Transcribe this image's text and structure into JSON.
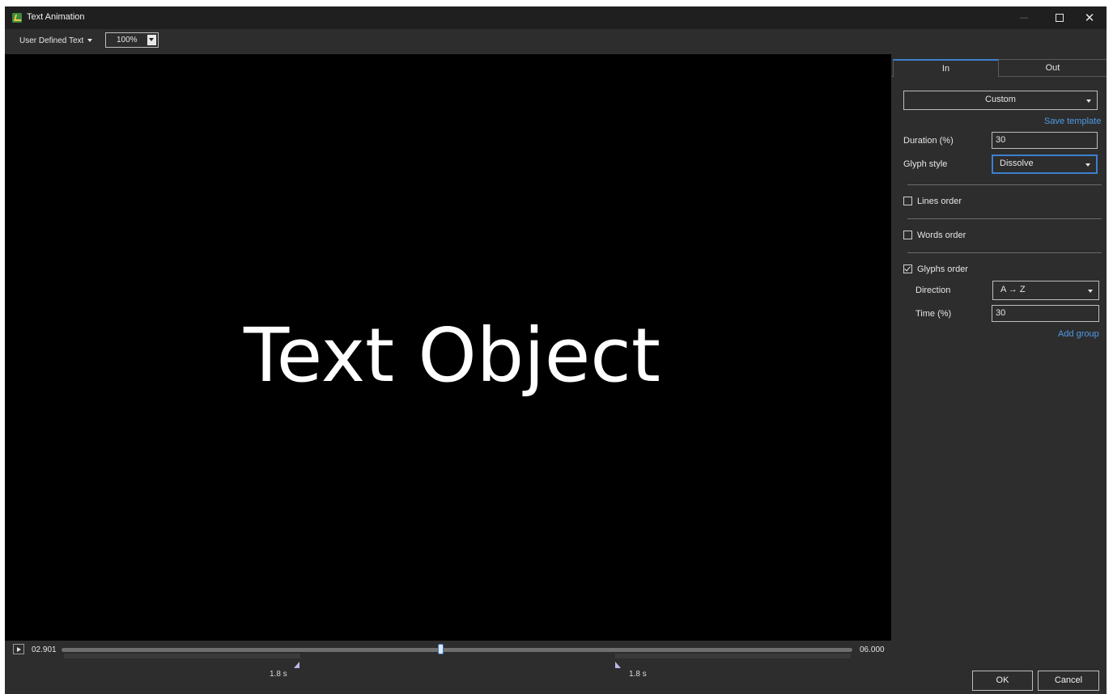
{
  "window": {
    "title": "Text Animation"
  },
  "toolbar": {
    "preset": "User Defined Text",
    "zoom": "100%"
  },
  "canvas": {
    "text": "Text Object"
  },
  "timeline": {
    "current": "02.901",
    "end": "06.000",
    "in_duration": "1.8 s",
    "out_duration": "1.8 s",
    "position_fraction": 0.48
  },
  "panel": {
    "tabs": [
      {
        "label": "In",
        "active": true
      },
      {
        "label": "Out",
        "active": false
      }
    ],
    "preset": "Custom",
    "save_template": "Save template",
    "duration_label": "Duration (%)",
    "duration_value": "30",
    "glyph_style_label": "Glyph style",
    "glyph_style_value": "Dissolve",
    "lines_order_label": "Lines order",
    "lines_order_checked": false,
    "words_order_label": "Words order",
    "words_order_checked": false,
    "glyphs_order_label": "Glyphs order",
    "glyphs_order_checked": true,
    "direction_label": "Direction",
    "direction_value": "A → Z",
    "time_label": "Time (%)",
    "time_value": "30",
    "add_group": "Add group"
  },
  "buttons": {
    "ok": "OK",
    "cancel": "Cancel"
  },
  "icons": [
    "app-icon",
    "minimize-icon",
    "maximize-icon",
    "close-icon",
    "play-icon",
    "chevron-down-icon",
    "checkmark-icon"
  ],
  "colors": {
    "accent": "#3d7fcf",
    "link": "#4f9be8",
    "background": "#2d2d2d",
    "canvas": "#000000"
  }
}
